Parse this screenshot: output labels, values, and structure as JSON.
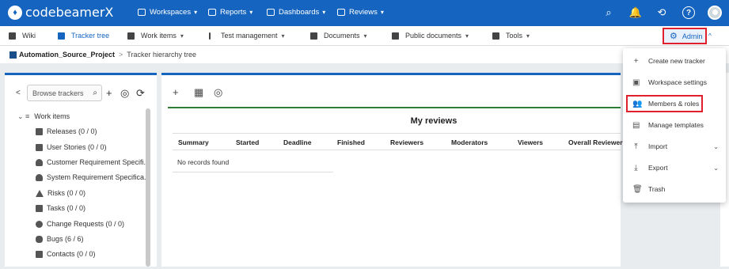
{
  "brand": {
    "name": "codebeamerX",
    "mark": "♦"
  },
  "topnav": [
    {
      "label": "Workspaces"
    },
    {
      "label": "Reports"
    },
    {
      "label": "Dashboards"
    },
    {
      "label": "Reviews"
    }
  ],
  "topicons": {
    "search": "⌕",
    "bell": "🔔",
    "history": "⟲",
    "help": "?"
  },
  "secnav": [
    {
      "label": "Wiki"
    },
    {
      "label": "Tracker tree"
    },
    {
      "label": "Work items"
    },
    {
      "label": "Test management"
    },
    {
      "label": "Documents"
    },
    {
      "label": "Public documents"
    },
    {
      "label": "Tools"
    }
  ],
  "admin": {
    "label": "Admin",
    "gear": "⚙",
    "caret": "^"
  },
  "breadcrumb": {
    "project": "Automation_Source_Project",
    "sep": ">",
    "page": "Tracker hierarchy tree"
  },
  "left": {
    "back": "<",
    "search_placeholder": "Browse trackers",
    "search_icon": "⌕",
    "add": "+",
    "hide": "◎",
    "sync": "⟳",
    "tree": [
      {
        "label": "Work items",
        "icon": "⌄ ≡"
      },
      {
        "label": "Releases  (0 / 0)",
        "icon": "release-icon"
      },
      {
        "label": "User Stories  (0 / 0)",
        "icon": "story-icon"
      },
      {
        "label": "Customer Requirement Specifi...",
        "icon": "bulb-icon"
      },
      {
        "label": "System Requirement Specifica...",
        "icon": "bulb-icon"
      },
      {
        "label": "Risks  (0 / 0)",
        "icon": "warning-icon"
      },
      {
        "label": "Tasks  (0 / 0)",
        "icon": "check-icon"
      },
      {
        "label": "Change Requests  (0 / 0)",
        "icon": "change-icon"
      },
      {
        "label": "Bugs  (6 / 6)",
        "icon": "bug-icon"
      },
      {
        "label": "Contacts  (0 / 0)",
        "icon": "contact-icon"
      }
    ]
  },
  "main": {
    "tools": {
      "add": "+",
      "table": "▦",
      "target": "◎"
    },
    "reviews": {
      "title": "My reviews",
      "columns": [
        "Summary",
        "Started",
        "Deadline",
        "Finished",
        "Reviewers",
        "Moderators",
        "Viewers",
        "Overall Reviewer S"
      ],
      "empty": "No records found"
    }
  },
  "dropdown": [
    {
      "label": "Create new tracker",
      "icon": "+"
    },
    {
      "label": "Workspace settings",
      "icon": "▣"
    },
    {
      "label": "Members & roles",
      "icon": "👥"
    },
    {
      "label": "Manage templates",
      "icon": "▤"
    },
    {
      "label": "Import",
      "icon": "⤒",
      "caret": "⌄"
    },
    {
      "label": "Export",
      "icon": "⤓",
      "caret": "⌄"
    },
    {
      "label": "Trash",
      "icon": "🗑"
    }
  ]
}
